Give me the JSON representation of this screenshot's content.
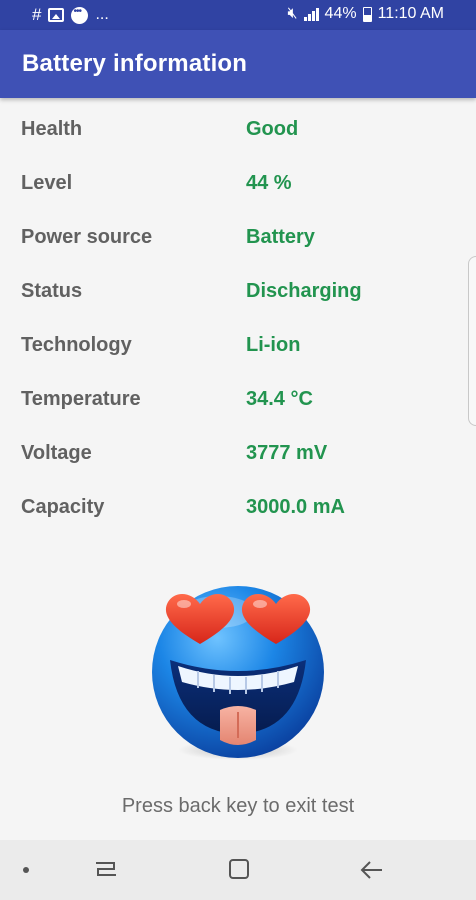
{
  "status_bar": {
    "hash_glyph": "#",
    "more_glyph": "...",
    "mute_glyph": "🔇︎",
    "battery_percent": "44%",
    "time": "11:10 AM"
  },
  "app_bar": {
    "title": "Battery information"
  },
  "info": [
    {
      "label": "Health",
      "value": "Good"
    },
    {
      "label": "Level",
      "value": "44 %"
    },
    {
      "label": "Power source",
      "value": "Battery"
    },
    {
      "label": "Status",
      "value": "Discharging"
    },
    {
      "label": "Technology",
      "value": "Li-ion"
    },
    {
      "label": "Temperature",
      "value": "34.4 °C"
    },
    {
      "label": "Voltage",
      "value": "3777 mV"
    },
    {
      "label": "Capacity",
      "value": "3000.0 mA"
    }
  ],
  "footer": {
    "hint": "Press back key to exit test"
  },
  "icons": {
    "emoji": "heart-eyes-emoji",
    "nav_dot": "dot-icon",
    "nav_recents": "recents-icon",
    "nav_home": "home-icon",
    "nav_back": "back-arrow-icon"
  },
  "colors": {
    "app_bar": "#3f51b5",
    "status_bar": "#3043a3",
    "value_green": "#22944f",
    "label_gray": "#616161"
  }
}
